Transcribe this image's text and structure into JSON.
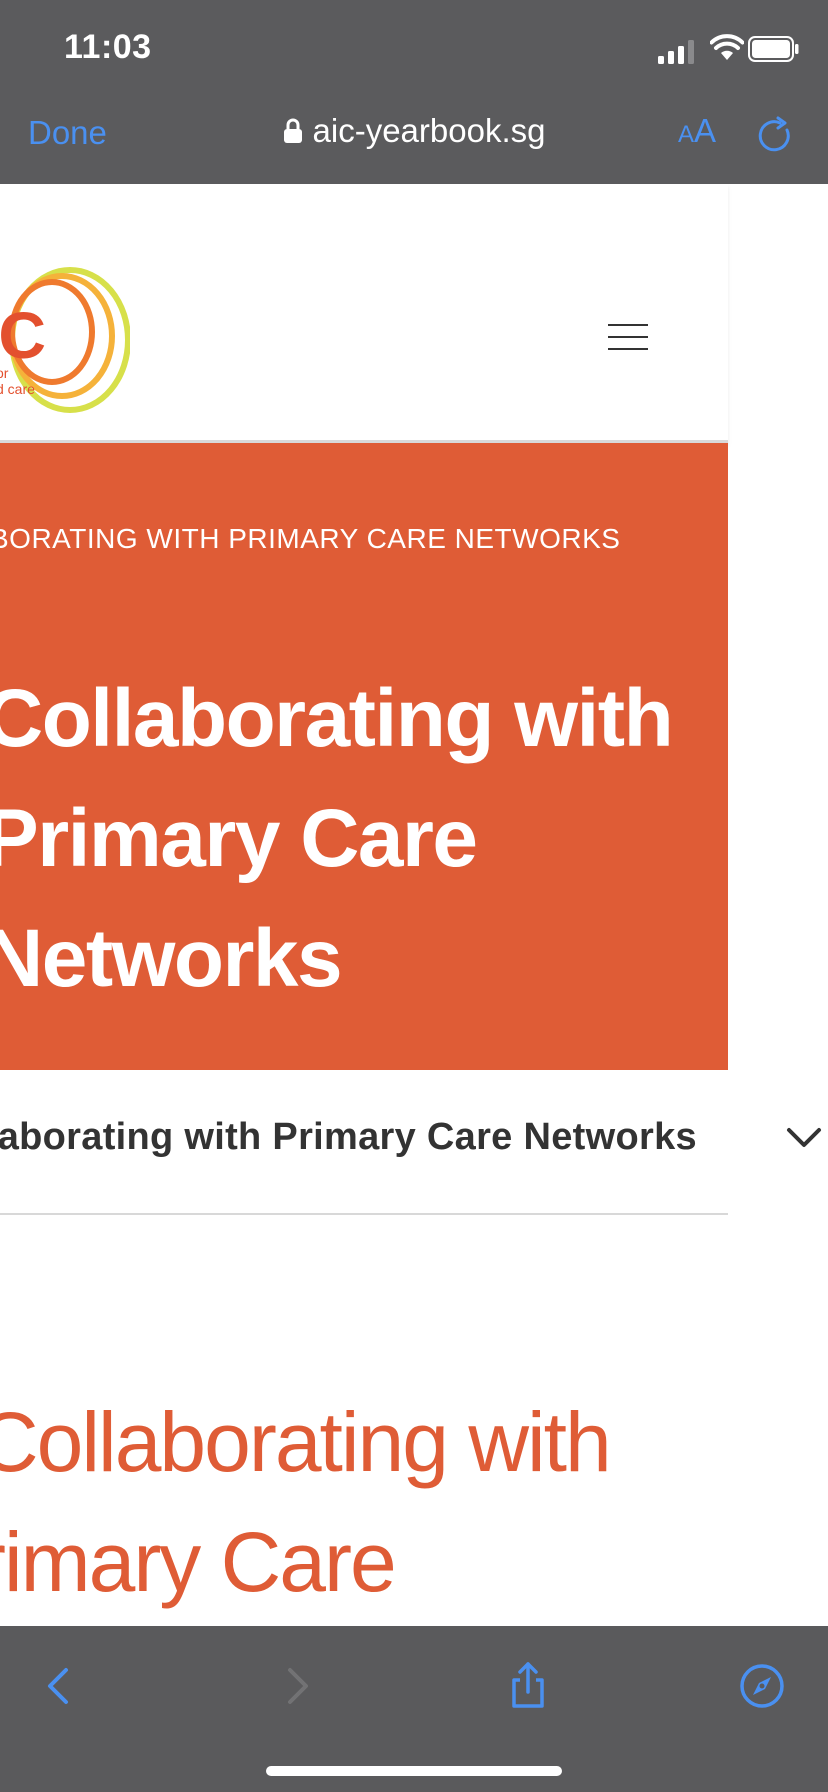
{
  "status_bar": {
    "time": "11:03"
  },
  "browser": {
    "done_label": "Done",
    "url": "aic-yearbook.sg",
    "text_size_label_small": "A",
    "text_size_label_large": "A",
    "accent_color": "#4a90f0"
  },
  "site": {
    "logo_text_main": "iC",
    "logo_text_line1": "or",
    "logo_text_line2": "d care",
    "hero": {
      "eyebrow": "BORATING WITH PRIMARY CARE NETWORKS",
      "title_lines": [
        "Collaborating with",
        "Primary Care",
        "Networks"
      ],
      "background_color": "#df5c36"
    },
    "dropdown": {
      "selected": "llaborating with Primary Care Networks"
    },
    "section": {
      "title_lines": [
        "Collaborating with",
        "rimary Care"
      ]
    }
  },
  "icons": {
    "status": [
      "signal-icon",
      "wifi-icon",
      "battery-icon"
    ],
    "toolbar": [
      "back-icon",
      "forward-icon",
      "share-icon",
      "compass-icon"
    ]
  }
}
